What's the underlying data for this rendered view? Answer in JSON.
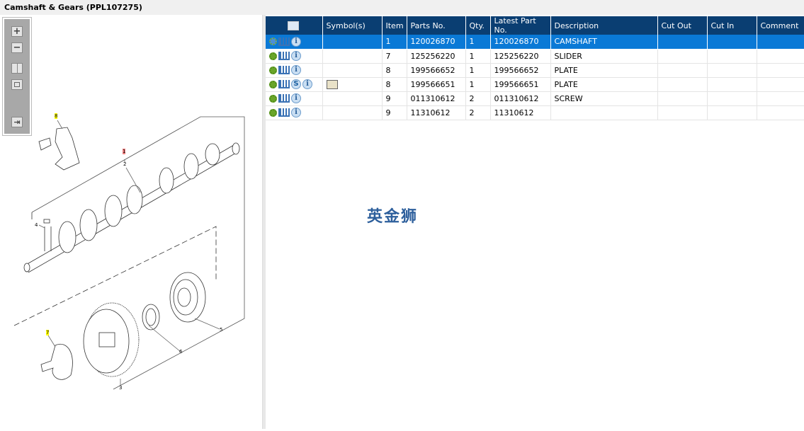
{
  "title": "Camshaft & Gears (PPL107275)",
  "toolbox": {
    "zoom_in": "+",
    "zoom_out": "−"
  },
  "diagram": {
    "callouts": [
      {
        "label": "8",
        "highlight": "#ffff00"
      },
      {
        "label": "1",
        "highlight": "#f08080"
      },
      {
        "label": "2"
      },
      {
        "label": "4"
      },
      {
        "label": "7",
        "highlight": "#ffff00"
      },
      {
        "label": "6"
      },
      {
        "label": "5"
      },
      {
        "label": "3"
      }
    ]
  },
  "table": {
    "headers": [
      "",
      "Symbol(s)",
      "Item",
      "Parts No.",
      "Qty.",
      "Latest Part No.",
      "Description",
      "Cut Out",
      "Cut In",
      "Comment"
    ],
    "rows": [
      {
        "item": "1",
        "part": "120026870",
        "qty": "1",
        "latest": "120026870",
        "desc": "CAMSHAFT",
        "selected": true,
        "icons": [
          "gears",
          "cart",
          "info"
        ]
      },
      {
        "item": "7",
        "part": "125256220",
        "qty": "1",
        "latest": "125256220",
        "desc": "SLIDER",
        "icons": [
          "gear",
          "cart",
          "info"
        ]
      },
      {
        "item": "8",
        "part": "199566652",
        "qty": "1",
        "latest": "199566652",
        "desc": "PLATE",
        "icons": [
          "gear",
          "cart",
          "info"
        ]
      },
      {
        "item": "8",
        "part": "199566651",
        "qty": "1",
        "latest": "199566651",
        "desc": "PLATE",
        "icons": [
          "gear",
          "cart",
          "s",
          "info"
        ],
        "symbol": "book-search"
      },
      {
        "item": "9",
        "part": "011310612",
        "qty": "2",
        "latest": "011310612",
        "desc": "SCREW",
        "icons": [
          "gear",
          "cart",
          "info"
        ]
      },
      {
        "item": "9",
        "part": "11310612",
        "qty": "2",
        "latest": "11310612",
        "desc": "",
        "icons": [
          "gear",
          "cart",
          "info"
        ]
      }
    ]
  },
  "icon_text": {
    "info": "i",
    "s": "S"
  },
  "watermark": "英金狮",
  "colors": {
    "header": "#0a3e72",
    "selected": "#0a79d6"
  }
}
